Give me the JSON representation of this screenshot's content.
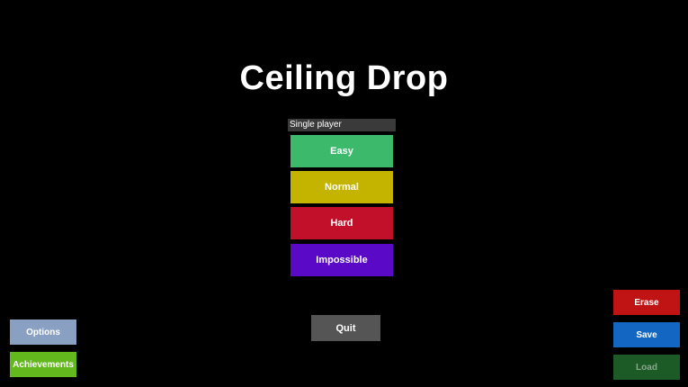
{
  "title": "Ceiling Drop",
  "mode_label": "Single player",
  "difficulties": [
    {
      "label": "Easy",
      "color": "#3cb96b"
    },
    {
      "label": "Normal",
      "color": "#c4b400"
    },
    {
      "label": "Hard",
      "color": "#c2102a"
    },
    {
      "label": "Impossible",
      "color": "#5a09c6"
    }
  ],
  "left_buttons": [
    {
      "label": "Options",
      "color": "#8aa0c2"
    },
    {
      "label": "Achievements",
      "color": "#62b81c"
    }
  ],
  "quit": {
    "label": "Quit",
    "color": "#555555"
  },
  "right_buttons": [
    {
      "label": "Erase",
      "color": "#c01414"
    },
    {
      "label": "Save",
      "color": "#1367c2"
    },
    {
      "label": "Load",
      "color": "#1c5a26"
    }
  ],
  "colors": {
    "background": "#000000",
    "text": "#ffffff",
    "label_bg": "#3a3a3a",
    "disabled_text": "#8aa88e"
  }
}
